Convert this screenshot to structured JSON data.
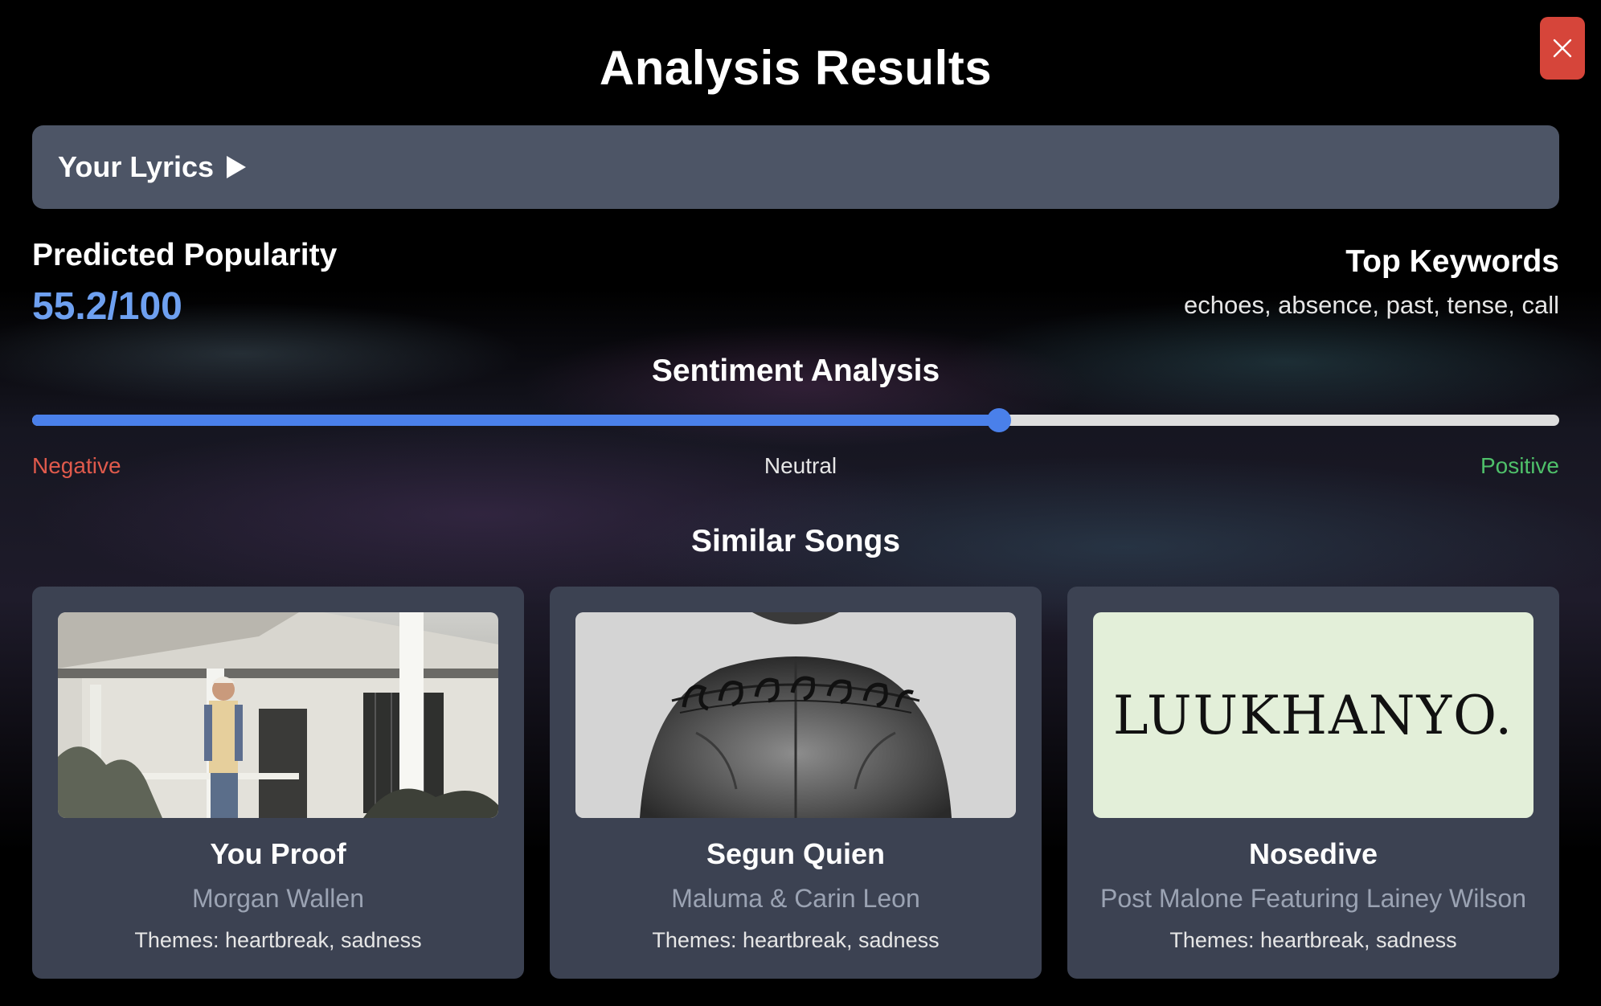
{
  "page": {
    "title": "Analysis Results",
    "close_icon": "close-icon"
  },
  "lyrics": {
    "label": "Your Lyrics",
    "toggle_icon": "play-triangle-icon"
  },
  "popularity": {
    "label": "Predicted Popularity",
    "value": "55.2/100"
  },
  "keywords": {
    "label": "Top Keywords",
    "value": "echoes, absence, past, tense, call"
  },
  "sentiment": {
    "title": "Sentiment Analysis",
    "level": 0.633,
    "scale": {
      "negative": "Negative",
      "neutral": "Neutral",
      "positive": "Positive"
    },
    "colors": {
      "fill": "#4a80ea",
      "track": "#dedede",
      "negative": "#e05a4c",
      "positive": "#4fc06a"
    }
  },
  "similar": {
    "title": "Similar Songs",
    "songs": [
      {
        "title": "You Proof",
        "artist": "Morgan Wallen",
        "themes": "Themes: heartbreak, sadness"
      },
      {
        "title": "Segun Quien",
        "artist": "Maluma & Carin Leon",
        "themes": "Themes: heartbreak, sadness"
      },
      {
        "title": "Nosedive",
        "artist": "Post Malone Featuring Lainey Wilson",
        "themes": "Themes: heartbreak, sadness",
        "cover_text": "LUUKHANYO."
      }
    ]
  },
  "colors": {
    "accent": "#6ea0f0",
    "close_button": "#d6453a",
    "panel": "#4d5566",
    "card": "#3c4252"
  }
}
